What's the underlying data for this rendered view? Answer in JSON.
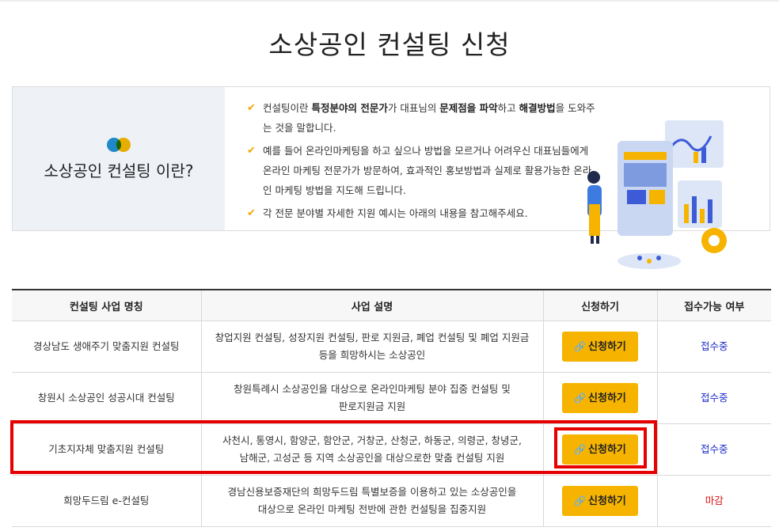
{
  "page": {
    "title": "소상공인 컨설팅 신청"
  },
  "intro": {
    "heading": "소상공인 컨설팅 이란?",
    "bullets": [
      {
        "parts": [
          "컨설팅이란 ",
          "특정분야의 전문가",
          "가 대표님의 ",
          "문제점을 파악",
          "하고 ",
          "해결방법",
          "을 도와주는 것을 말합니다."
        ]
      },
      {
        "text": "예를 들어 온라인마케팅을 하고 싶으나 방법을 모르거나 어려우신 대표님들에게 온라인 마케팅 전문가가 방문하여, 효과적인 홍보방법과 실제로 활용가능한 온라인 마케팅 방법을 지도해 드립니다."
      },
      {
        "text": "각 전문 분야별 자세한 지원 예시는 아래의 내용을 참고해주세요."
      }
    ]
  },
  "table": {
    "headers": [
      "컨설팅 사업 명칭",
      "사업 설명",
      "신청하기",
      "접수가능 여부"
    ],
    "apply_label": "신청하기",
    "rows": [
      {
        "name": "경상남도 생애주기 맞춤지원 컨설팅",
        "desc_line1": "창업지원 컨설팅, 성장지원 컨설팅, 판로 지원금, 폐업 컨설팅 및 폐업 지원금",
        "desc_line2": "등을 희망하시는 소상공인",
        "status": "접수중"
      },
      {
        "name": "창원시 소상공인 성공시대 컨설팅",
        "desc_line1": "창원특례시 소상공인을 대상으로 온라인마케팅 분야 집중 컨설팅 및",
        "desc_line2": "판로지원금 지원",
        "status": "접수중"
      },
      {
        "name": "기초지자체 맞춤지원 컨설팅",
        "desc_line1": "사천시, 통영시, 함양군, 함안군, 거창군, 산청군, 하동군, 의령군, 창녕군,",
        "desc_line2": "남해군, 고성군 등 지역 소상공인을 대상으로한 맞춤 컨설팅 지원",
        "status": "접수중"
      },
      {
        "name": "희망두드림 e-컨설팅",
        "desc_line1": "경남신용보증재단의 희망두드림 특별보증을 이용하고 있는 소상공인을",
        "desc_line2": "대상으로 온라인 마케팅 전반에 관한 컨설팅을 집중지원",
        "status": "마감"
      }
    ]
  },
  "colors": {
    "accent": "#f6b400",
    "status_open": "#1c2ccb",
    "status_closed": "#e01010",
    "highlight": "#e60000"
  },
  "icons": {
    "check": "check-icon",
    "link": "link-icon",
    "logo": "two-dots-logo-icon"
  }
}
